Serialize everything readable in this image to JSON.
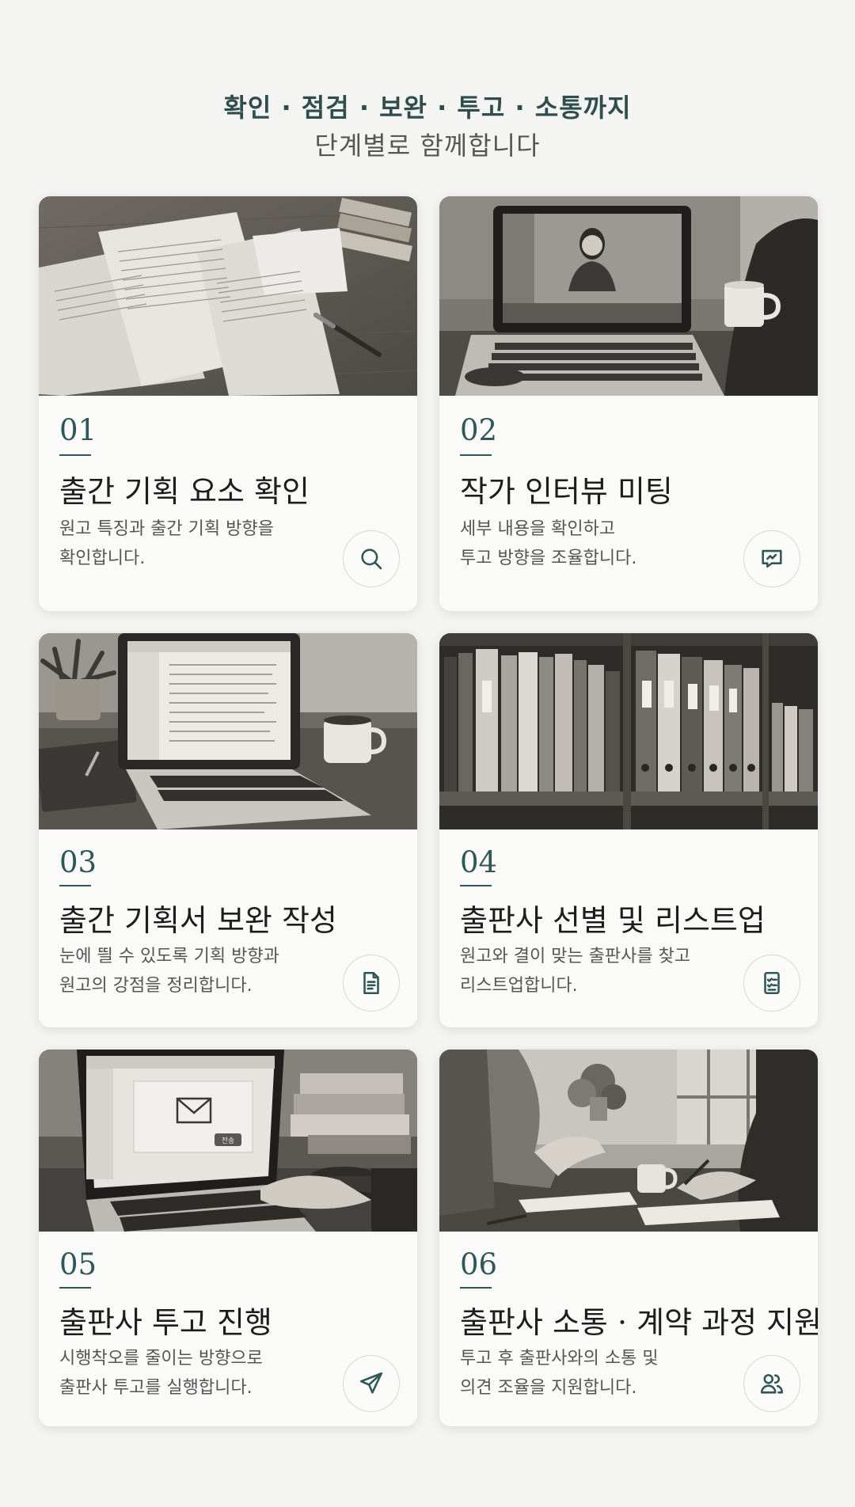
{
  "header": {
    "line1": "확인 · 점검 · 보완 · 투고 · 소통까지",
    "line2": "단계별로 함께합니다"
  },
  "steps": [
    {
      "number": "01",
      "title": "출간 기획 요소 확인",
      "desc_line1": "원고 특징과 출간 기획 방향을",
      "desc_line2": "확인합니다.",
      "icon": "search-icon",
      "photo": "manuscript-papers-photo"
    },
    {
      "number": "02",
      "title": "작가 인터뷰 미팅",
      "desc_line1": "세부 내용을 확인하고",
      "desc_line2": "투고 방향을 조율합니다.",
      "icon": "chat-icon",
      "photo": "video-call-laptop-photo"
    },
    {
      "number": "03",
      "title": "출간 기획서 보완 작성",
      "desc_line1": "눈에 띌 수 있도록 기획 방향과",
      "desc_line2": "원고의 강점을 정리합니다.",
      "icon": "document-icon",
      "photo": "laptop-document-photo"
    },
    {
      "number": "04",
      "title": "출판사 선별 및 리스트업",
      "desc_line1": "원고와 결이 맞는 출판사를 찾고",
      "desc_line2": "리스트업합니다.",
      "icon": "checklist-icon",
      "photo": "binder-shelf-photo"
    },
    {
      "number": "05",
      "title": "출판사 투고 진행",
      "desc_line1": "시행착오를 줄이는 방향으로",
      "desc_line2": "출판사 투고를 실행합니다.",
      "icon": "send-icon",
      "photo": "laptop-email-photo"
    },
    {
      "number": "06",
      "title": "출판사 소통 · 계약 과정 지원",
      "desc_line1": "투고 후 출판사와의 소통 및",
      "desc_line2": "의견 조율을 지원합니다.",
      "icon": "users-icon",
      "photo": "meeting-table-photo"
    }
  ],
  "photo_texts": {
    "send_label": "전송"
  },
  "colors": {
    "accent": "#2f5757",
    "background": "#f4f4f2",
    "card": "#fafaf9"
  }
}
